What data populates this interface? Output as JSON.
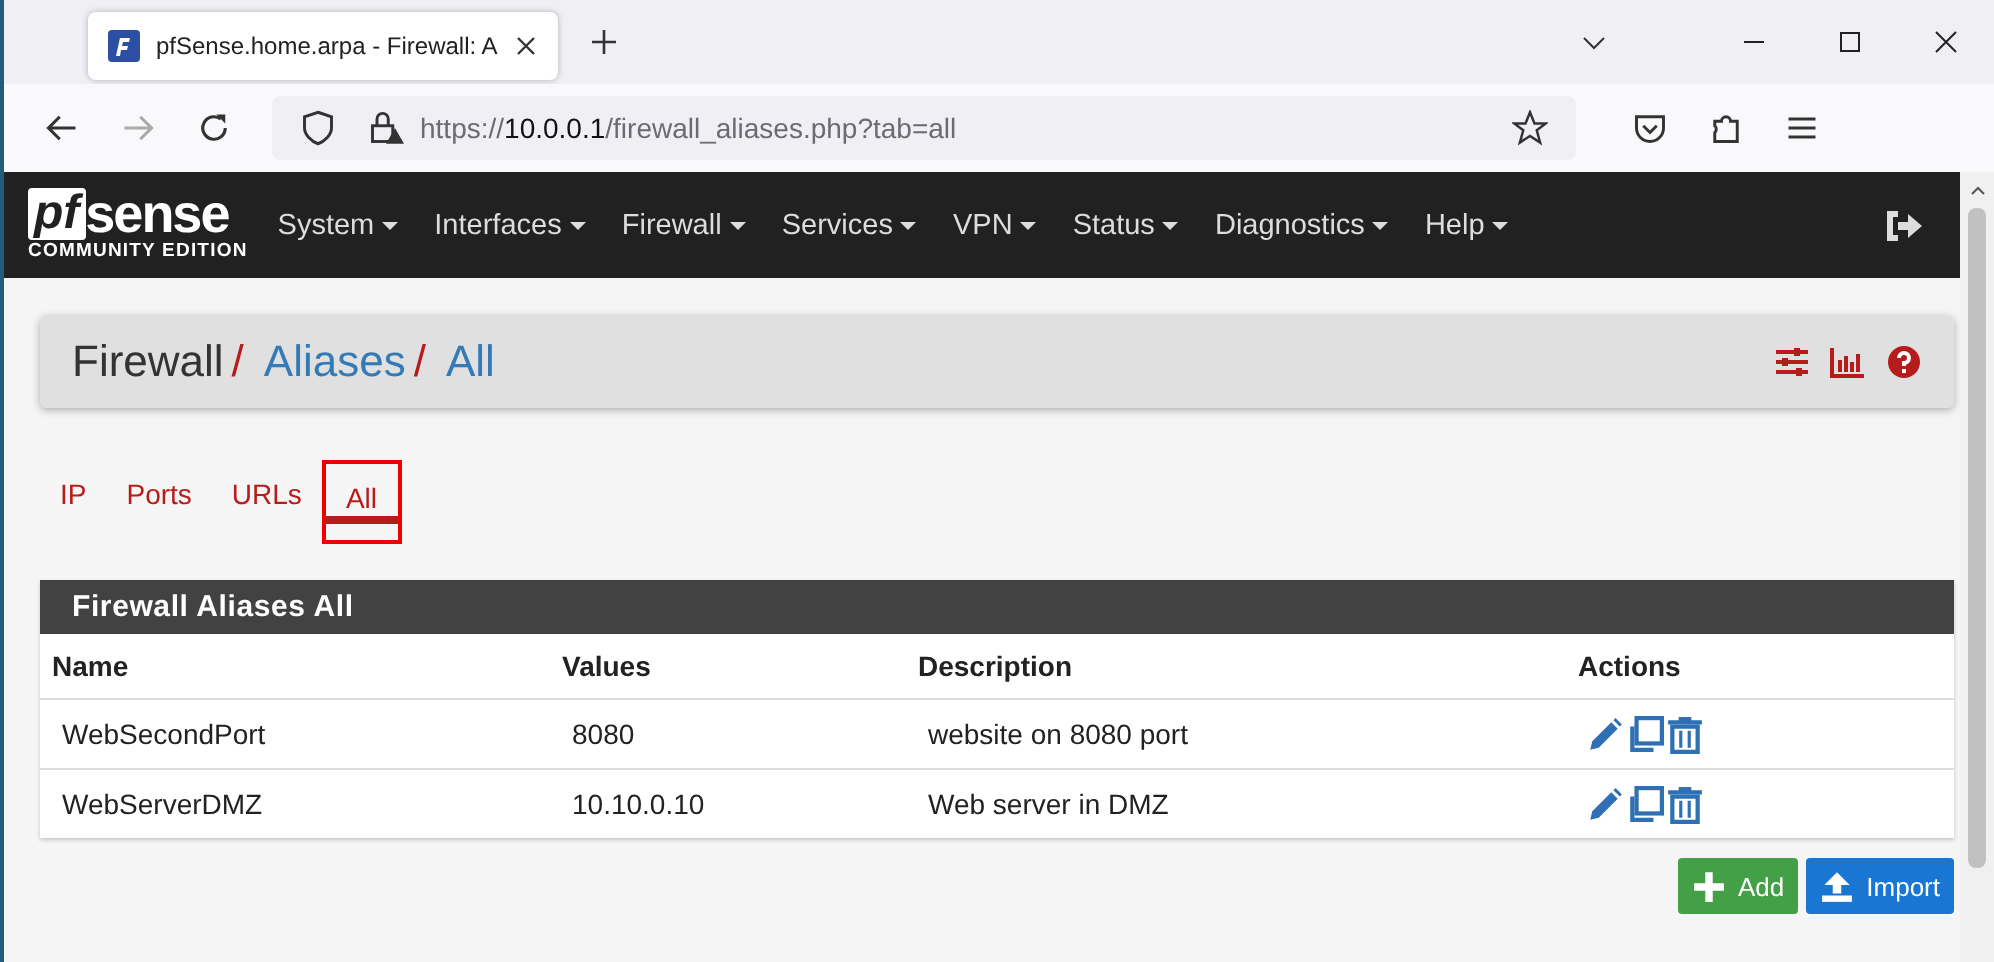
{
  "browser": {
    "tab_title": "pfSense.home.arpa - Firewall: A",
    "url": {
      "scheme": "https://",
      "host": "10.0.0.1",
      "path": "/firewall_aliases.php?tab=all"
    }
  },
  "logo": {
    "brand_a": "pf",
    "brand_b": "sense",
    "edition": "COMMUNITY EDITION"
  },
  "menu": [
    "System",
    "Interfaces",
    "Firewall",
    "Services",
    "VPN",
    "Status",
    "Diagnostics",
    "Help"
  ],
  "breadcrumb": [
    {
      "label": "Firewall",
      "link": false
    },
    {
      "separator": "/",
      "label": "Aliases",
      "link": true
    },
    {
      "separator": "/",
      "label": "All",
      "link": true
    }
  ],
  "tabs": [
    {
      "label": "IP",
      "selected": false
    },
    {
      "label": "Ports",
      "selected": false
    },
    {
      "label": "URLs",
      "selected": false
    },
    {
      "label": "All",
      "selected": true
    }
  ],
  "table": {
    "title": "Firewall Aliases All",
    "columns": [
      "Name",
      "Values",
      "Description",
      "Actions"
    ],
    "rows": [
      {
        "name": "WebSecondPort",
        "values": "8080",
        "description": "website on 8080 port"
      },
      {
        "name": "WebServerDMZ",
        "values": "10.10.0.10",
        "description": "Web server in DMZ"
      }
    ]
  },
  "buttons": [
    {
      "label": "Add",
      "kind": "add"
    },
    {
      "label": "Import",
      "kind": "import"
    }
  ]
}
